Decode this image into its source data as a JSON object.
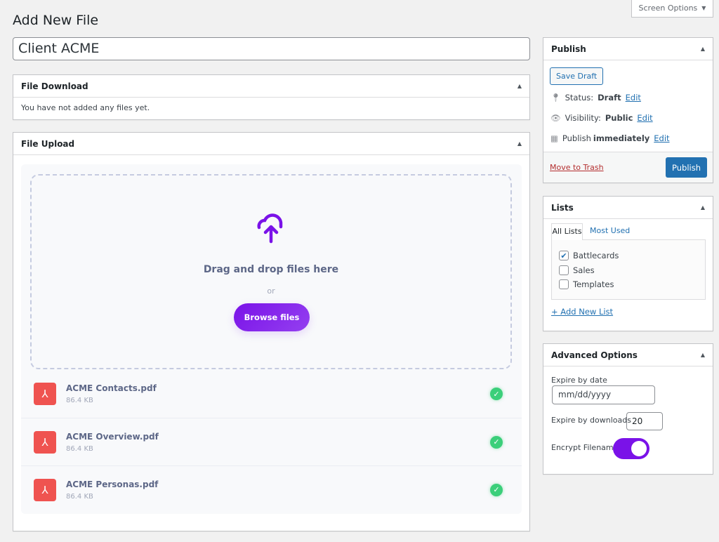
{
  "screen_options": "Screen Options",
  "page_title": "Add New File",
  "title_value": "Client ACME",
  "file_download": {
    "title": "File Download",
    "empty_text": "You have not added any files yet."
  },
  "file_upload": {
    "title": "File Upload",
    "drop_text": "Drag and drop files here",
    "or": "or",
    "browse": "Browse files",
    "files": [
      {
        "name": "ACME Contacts.pdf",
        "size": "86.4 KB"
      },
      {
        "name": "ACME Overview.pdf",
        "size": "86.4 KB"
      },
      {
        "name": "ACME Personas.pdf",
        "size": "86.4 KB"
      }
    ],
    "accent": "#7a12e8"
  },
  "publish": {
    "title": "Publish",
    "save_draft": "Save Draft",
    "status_label": "Status:",
    "status": "Draft",
    "visibility_label": "Visibility:",
    "visibility": "Public",
    "publish_label": "Publish",
    "publish_when": "immediately",
    "edit": "Edit",
    "trash": "Move to Trash",
    "publish_button": "Publish"
  },
  "lists": {
    "title": "Lists",
    "tabs": [
      "All Lists",
      "Most Used"
    ],
    "items": [
      {
        "label": "Battlecards",
        "checked": true
      },
      {
        "label": "Sales",
        "checked": false
      },
      {
        "label": "Templates",
        "checked": false
      }
    ],
    "add_new": "+ Add New List"
  },
  "advanced": {
    "title": "Advanced Options",
    "expire_date_label": "Expire by date",
    "expire_date_placeholder": "mm/dd/yyyy",
    "expire_downloads_label": "Expire by downloads",
    "expire_downloads_value": "20",
    "encrypt_label": "Encrypt Filename",
    "encrypt_on": true
  }
}
